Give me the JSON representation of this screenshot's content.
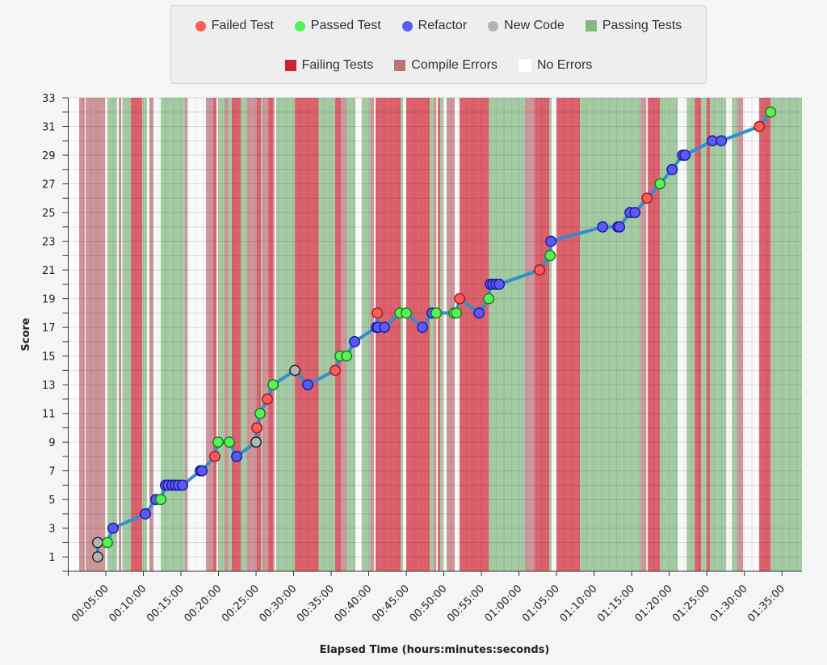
{
  "legend": {
    "items": [
      {
        "label": "Failed Test",
        "shape": "dot",
        "color": "#ff5b5b"
      },
      {
        "label": "Passed Test",
        "shape": "dot",
        "color": "#56f256"
      },
      {
        "label": "Refactor",
        "shape": "dot",
        "color": "#5a5af5"
      },
      {
        "label": "New Code",
        "shape": "dot",
        "color": "#b4b4b4"
      },
      {
        "label": "Passing Tests",
        "shape": "square",
        "color": "#86b883"
      },
      {
        "label": "Failing Tests",
        "shape": "square",
        "color": "#c9242f"
      },
      {
        "label": "Compile Errors",
        "shape": "square",
        "color": "#bf7275"
      },
      {
        "label": "No Errors",
        "shape": "square",
        "color": "#ffffff"
      }
    ]
  },
  "chart_data": {
    "type": "line",
    "title": "",
    "xlabel": "Elapsed Time (hours:minutes:seconds)",
    "ylabel": "Score",
    "xlim_seconds": [
      0,
      5860
    ],
    "ylim": [
      0,
      33
    ],
    "grid": true,
    "legend_position": "top-center",
    "y_ticks": [
      1,
      3,
      5,
      7,
      9,
      11,
      13,
      15,
      17,
      19,
      21,
      23,
      25,
      27,
      29,
      31,
      33
    ],
    "x_ticks": [
      {
        "seconds": 300,
        "label": "00:05:00"
      },
      {
        "seconds": 600,
        "label": "00:10:00"
      },
      {
        "seconds": 900,
        "label": "00:15:00"
      },
      {
        "seconds": 1200,
        "label": "00:20:00"
      },
      {
        "seconds": 1500,
        "label": "00:25:00"
      },
      {
        "seconds": 1800,
        "label": "00:30:00"
      },
      {
        "seconds": 2100,
        "label": "00:35:00"
      },
      {
        "seconds": 2400,
        "label": "00:40:00"
      },
      {
        "seconds": 2700,
        "label": "00:45:00"
      },
      {
        "seconds": 3000,
        "label": "00:50:00"
      },
      {
        "seconds": 3300,
        "label": "00:55:00"
      },
      {
        "seconds": 3600,
        "label": "01:00:00"
      },
      {
        "seconds": 3900,
        "label": "01:05:00"
      },
      {
        "seconds": 4200,
        "label": "01:10:00"
      },
      {
        "seconds": 4500,
        "label": "01:15:00"
      },
      {
        "seconds": 4800,
        "label": "01:20:00"
      },
      {
        "seconds": 5100,
        "label": "01:25:00"
      },
      {
        "seconds": 5400,
        "label": "01:30:00"
      },
      {
        "seconds": 5700,
        "label": "01:35:00"
      }
    ],
    "line_color": "#2f8fd0",
    "point_types": {
      "fail": "#ff5b5b",
      "pass": "#56f256",
      "refactor": "#5a5af5",
      "new": "#b4b4b4"
    },
    "points": [
      {
        "t": 235,
        "score": 1,
        "type": "new"
      },
      {
        "t": 235,
        "score": 2,
        "type": "new"
      },
      {
        "t": 313,
        "score": 2,
        "type": "pass"
      },
      {
        "t": 358,
        "score": 3,
        "type": "refactor"
      },
      {
        "t": 616,
        "score": 4,
        "type": "refactor"
      },
      {
        "t": 700,
        "score": 5,
        "type": "refactor"
      },
      {
        "t": 739,
        "score": 5,
        "type": "pass"
      },
      {
        "t": 777,
        "score": 6,
        "type": "refactor"
      },
      {
        "t": 797,
        "score": 6,
        "type": "refactor"
      },
      {
        "t": 829,
        "score": 6,
        "type": "refactor"
      },
      {
        "t": 855,
        "score": 6,
        "type": "refactor"
      },
      {
        "t": 881,
        "score": 6,
        "type": "refactor"
      },
      {
        "t": 913,
        "score": 6,
        "type": "refactor"
      },
      {
        "t": 1055,
        "score": 7,
        "type": "refactor"
      },
      {
        "t": 1068,
        "score": 7,
        "type": "refactor"
      },
      {
        "t": 1171,
        "score": 8,
        "type": "fail"
      },
      {
        "t": 1197,
        "score": 9,
        "type": "pass"
      },
      {
        "t": 1287,
        "score": 9,
        "type": "pass"
      },
      {
        "t": 1345,
        "score": 8,
        "type": "refactor"
      },
      {
        "t": 1500,
        "score": 9,
        "type": "new"
      },
      {
        "t": 1506,
        "score": 10,
        "type": "fail"
      },
      {
        "t": 1532,
        "score": 11,
        "type": "pass"
      },
      {
        "t": 1590,
        "score": 12,
        "type": "fail"
      },
      {
        "t": 1636,
        "score": 13,
        "type": "pass"
      },
      {
        "t": 1810,
        "score": 14,
        "type": "new"
      },
      {
        "t": 1913,
        "score": 13,
        "type": "refactor"
      },
      {
        "t": 2132,
        "score": 14,
        "type": "fail"
      },
      {
        "t": 2171,
        "score": 15,
        "type": "pass"
      },
      {
        "t": 2223,
        "score": 15,
        "type": "pass"
      },
      {
        "t": 2287,
        "score": 16,
        "type": "refactor"
      },
      {
        "t": 2461,
        "score": 17,
        "type": "refactor"
      },
      {
        "t": 2468,
        "score": 18,
        "type": "fail"
      },
      {
        "t": 2474,
        "score": 17,
        "type": "refactor"
      },
      {
        "t": 2526,
        "score": 17,
        "type": "refactor"
      },
      {
        "t": 2649,
        "score": 18,
        "type": "pass"
      },
      {
        "t": 2700,
        "score": 18,
        "type": "pass"
      },
      {
        "t": 2829,
        "score": 17,
        "type": "refactor"
      },
      {
        "t": 2906,
        "score": 18,
        "type": "refactor"
      },
      {
        "t": 2939,
        "score": 18,
        "type": "pass"
      },
      {
        "t": 3081,
        "score": 18,
        "type": "pass"
      },
      {
        "t": 3100,
        "score": 18,
        "type": "pass"
      },
      {
        "t": 3126,
        "score": 19,
        "type": "fail"
      },
      {
        "t": 3281,
        "score": 18,
        "type": "refactor"
      },
      {
        "t": 3358,
        "score": 19,
        "type": "pass"
      },
      {
        "t": 3371,
        "score": 20,
        "type": "refactor"
      },
      {
        "t": 3390,
        "score": 20,
        "type": "refactor"
      },
      {
        "t": 3416,
        "score": 20,
        "type": "refactor"
      },
      {
        "t": 3442,
        "score": 20,
        "type": "refactor"
      },
      {
        "t": 3765,
        "score": 21,
        "type": "fail"
      },
      {
        "t": 3849,
        "score": 22,
        "type": "pass"
      },
      {
        "t": 3855,
        "score": 23,
        "type": "refactor"
      },
      {
        "t": 4268,
        "score": 24,
        "type": "refactor"
      },
      {
        "t": 4390,
        "score": 24,
        "type": "refactor"
      },
      {
        "t": 4403,
        "score": 24,
        "type": "refactor"
      },
      {
        "t": 4487,
        "score": 25,
        "type": "refactor"
      },
      {
        "t": 4526,
        "score": 25,
        "type": "refactor"
      },
      {
        "t": 4623,
        "score": 26,
        "type": "fail"
      },
      {
        "t": 4726,
        "score": 27,
        "type": "pass"
      },
      {
        "t": 4823,
        "score": 28,
        "type": "refactor"
      },
      {
        "t": 4907,
        "score": 29,
        "type": "refactor"
      },
      {
        "t": 4926,
        "score": 29,
        "type": "refactor"
      },
      {
        "t": 5145,
        "score": 30,
        "type": "refactor"
      },
      {
        "t": 5216,
        "score": 30,
        "type": "refactor"
      },
      {
        "t": 5519,
        "score": 31,
        "type": "fail"
      },
      {
        "t": 5610,
        "score": 32,
        "type": "pass"
      }
    ],
    "band_colors": {
      "passing": "#9cc69b",
      "failing": "#d9545f",
      "compile": "#c98d92",
      "none": "#ffffff"
    },
    "bands": [
      {
        "start": 0,
        "end": 87,
        "state": "none"
      },
      {
        "start": 87,
        "end": 132,
        "state": "compile"
      },
      {
        "start": 139,
        "end": 294,
        "state": "compile"
      },
      {
        "start": 313,
        "end": 390,
        "state": "passing"
      },
      {
        "start": 403,
        "end": 423,
        "state": "compile"
      },
      {
        "start": 432,
        "end": 500,
        "state": "passing"
      },
      {
        "start": 500,
        "end": 590,
        "state": "failing"
      },
      {
        "start": 590,
        "end": 629,
        "state": "passing"
      },
      {
        "start": 648,
        "end": 681,
        "state": "compile"
      },
      {
        "start": 739,
        "end": 932,
        "state": "passing"
      },
      {
        "start": 932,
        "end": 952,
        "state": "compile"
      },
      {
        "start": 1100,
        "end": 1132,
        "state": "compile"
      },
      {
        "start": 1132,
        "end": 1158,
        "state": "compile"
      },
      {
        "start": 1158,
        "end": 1184,
        "state": "failing"
      },
      {
        "start": 1197,
        "end": 1248,
        "state": "passing"
      },
      {
        "start": 1248,
        "end": 1281,
        "state": "compile"
      },
      {
        "start": 1281,
        "end": 1306,
        "state": "passing"
      },
      {
        "start": 1306,
        "end": 1377,
        "state": "failing"
      },
      {
        "start": 1377,
        "end": 1423,
        "state": "passing"
      },
      {
        "start": 1423,
        "end": 1506,
        "state": "compile"
      },
      {
        "start": 1506,
        "end": 1539,
        "state": "failing"
      },
      {
        "start": 1539,
        "end": 1552,
        "state": "passing"
      },
      {
        "start": 1552,
        "end": 1597,
        "state": "compile"
      },
      {
        "start": 1597,
        "end": 1635,
        "state": "failing"
      },
      {
        "start": 1635,
        "end": 1648,
        "state": "compile"
      },
      {
        "start": 1661,
        "end": 1700,
        "state": "passing"
      },
      {
        "start": 1700,
        "end": 1810,
        "state": "passing"
      },
      {
        "start": 1810,
        "end": 2000,
        "state": "failing"
      },
      {
        "start": 2000,
        "end": 2132,
        "state": "passing"
      },
      {
        "start": 2132,
        "end": 2177,
        "state": "failing"
      },
      {
        "start": 2177,
        "end": 2223,
        "state": "compile"
      },
      {
        "start": 2223,
        "end": 2293,
        "state": "passing"
      },
      {
        "start": 2345,
        "end": 2410,
        "state": "passing"
      },
      {
        "start": 2410,
        "end": 2442,
        "state": "compile"
      },
      {
        "start": 2455,
        "end": 2655,
        "state": "failing"
      },
      {
        "start": 2655,
        "end": 2674,
        "state": "passing"
      },
      {
        "start": 2700,
        "end": 2887,
        "state": "failing"
      },
      {
        "start": 2887,
        "end": 2919,
        "state": "passing"
      },
      {
        "start": 2919,
        "end": 2939,
        "state": "compile"
      },
      {
        "start": 2952,
        "end": 2971,
        "state": "failing"
      },
      {
        "start": 2971,
        "end": 2997,
        "state": "passing"
      },
      {
        "start": 3022,
        "end": 3087,
        "state": "compile"
      },
      {
        "start": 3126,
        "end": 3358,
        "state": "failing"
      },
      {
        "start": 3358,
        "end": 3648,
        "state": "passing"
      },
      {
        "start": 3648,
        "end": 3726,
        "state": "compile"
      },
      {
        "start": 3726,
        "end": 3842,
        "state": "failing"
      },
      {
        "start": 3842,
        "end": 3861,
        "state": "passing"
      },
      {
        "start": 3900,
        "end": 4087,
        "state": "failing"
      },
      {
        "start": 4087,
        "end": 4571,
        "state": "passing"
      },
      {
        "start": 4571,
        "end": 4616,
        "state": "compile"
      },
      {
        "start": 4629,
        "end": 4726,
        "state": "failing"
      },
      {
        "start": 4726,
        "end": 4868,
        "state": "passing"
      },
      {
        "start": 4939,
        "end": 5003,
        "state": "passing"
      },
      {
        "start": 5003,
        "end": 5055,
        "state": "failing"
      },
      {
        "start": 5055,
        "end": 5100,
        "state": "passing"
      },
      {
        "start": 5100,
        "end": 5126,
        "state": "failing"
      },
      {
        "start": 5126,
        "end": 5255,
        "state": "passing"
      },
      {
        "start": 5300,
        "end": 5345,
        "state": "passing"
      },
      {
        "start": 5345,
        "end": 5390,
        "state": "compile"
      },
      {
        "start": 5519,
        "end": 5610,
        "state": "failing"
      },
      {
        "start": 5610,
        "end": 5860,
        "state": "passing"
      }
    ]
  }
}
